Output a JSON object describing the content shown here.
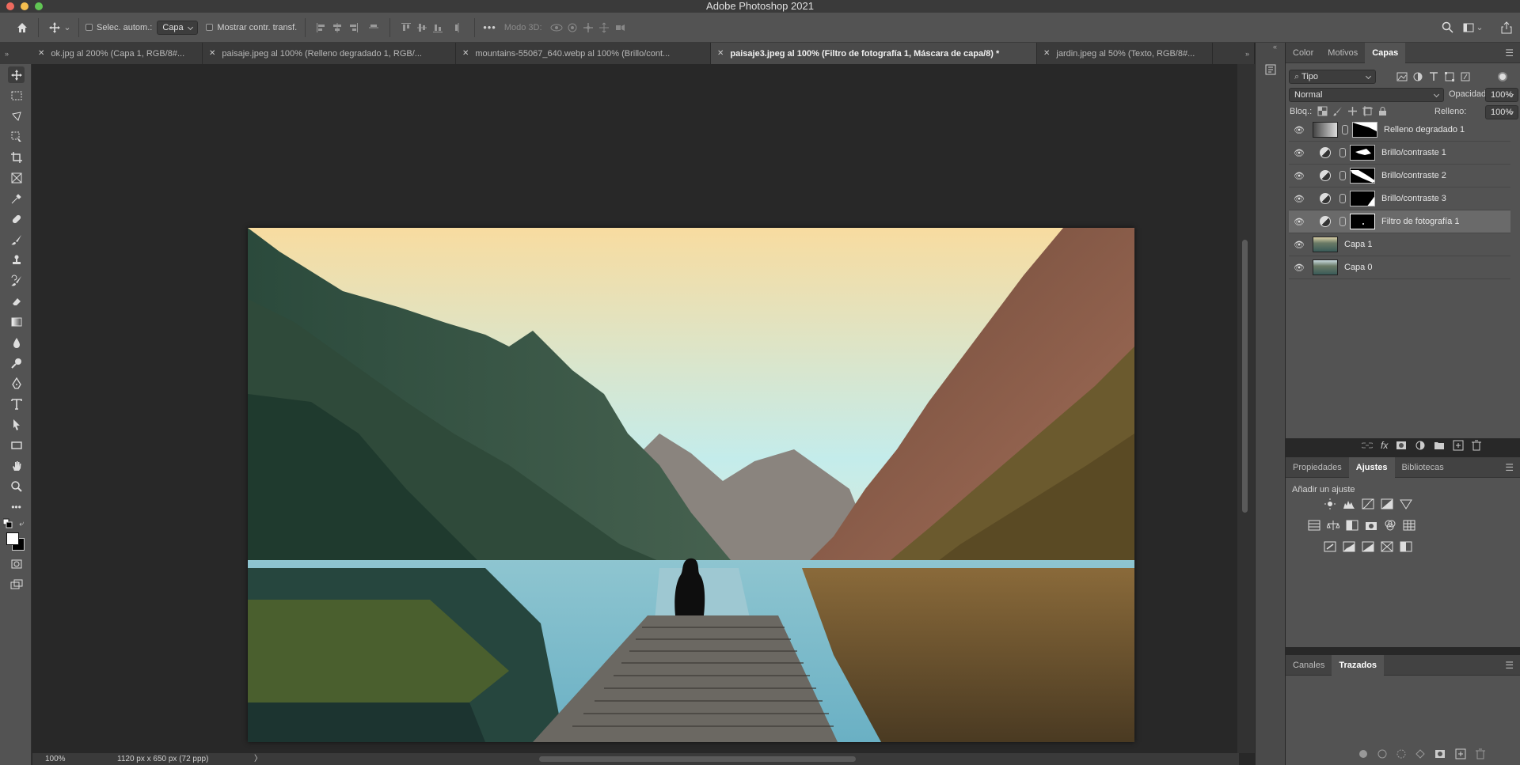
{
  "app": {
    "title": "Adobe Photoshop 2021"
  },
  "options": {
    "auto_select_label": "Selec. autom.:",
    "auto_select_value": "Capa",
    "show_transform_label": "Mostrar contr. transf.",
    "mode3d_label": "Modo 3D:",
    "more_label": "•••"
  },
  "tabs": [
    {
      "label": "ok.jpg al 200% (Capa 1, RGB/8#..."
    },
    {
      "label": "paisaje.jpeg al 100% (Relleno degradado 1, RGB/..."
    },
    {
      "label": "mountains-55067_640.webp al 100% (Brillo/cont..."
    },
    {
      "label": "paisaje3.jpeg al 100% (Filtro de fotografía 1, Máscara de capa/8) *"
    },
    {
      "label": "jardin.jpeg al 50% (Texto, RGB/8#..."
    }
  ],
  "status": {
    "zoom": "100%",
    "doc_info": "1120 px x 650 px (72 ppp)",
    "arrow": "〉"
  },
  "panel_top": {
    "tabs": [
      "Color",
      "Motivos",
      "Capas"
    ],
    "filter_label": "Tipo",
    "blend_mode": "Normal",
    "opacity_label": "Opacidad:",
    "opacity_value": "100%",
    "lock_label": "Bloq.:",
    "fill_label": "Relleno:",
    "fill_value": "100%",
    "layers": [
      {
        "name": "Relleno degradado 1"
      },
      {
        "name": "Brillo/contraste 1"
      },
      {
        "name": "Brillo/contraste 2"
      },
      {
        "name": "Brillo/contraste 3"
      },
      {
        "name": "Filtro de fotografía 1"
      },
      {
        "name": "Capa 1"
      },
      {
        "name": "Capa 0"
      }
    ],
    "fx_label": "fx"
  },
  "panel_mid": {
    "tabs": [
      "Propiedades",
      "Ajustes",
      "Bibliotecas"
    ],
    "add_adjustment": "Añadir un ajuste"
  },
  "panel_bottom": {
    "tabs": [
      "Canales",
      "Trazados"
    ]
  },
  "colors": {
    "accent": "#535353",
    "selected_layer": "#6a6a6a"
  }
}
